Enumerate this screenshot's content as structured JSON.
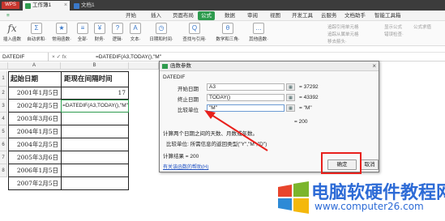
{
  "titlebar": {
    "app": "WPS",
    "tabs": [
      {
        "label": "工作簿1",
        "color": "#2e9b4e"
      },
      {
        "label": "文档1",
        "color": "#3a78c8"
      }
    ]
  },
  "menu": [
    "开始",
    "插入",
    "页面布局",
    "公式",
    "数据",
    "审阅",
    "视图",
    "开发工具",
    "云服务",
    "文档助手",
    "智能工具箱"
  ],
  "menu_active": "公式",
  "ribbon": {
    "buttons": [
      {
        "label": "插入函数",
        "icon": "fx"
      },
      {
        "label": "自动求和·",
        "icon": "Σ"
      },
      {
        "label": "常用函数·",
        "icon": "★"
      },
      {
        "label": "全部·",
        "icon": "≡"
      },
      {
        "label": "财务·",
        "icon": "¥"
      },
      {
        "label": "逻辑·",
        "icon": "?"
      },
      {
        "label": "文本·",
        "icon": "A"
      },
      {
        "label": "日期和时间·",
        "icon": "◷"
      },
      {
        "label": "查找与引用·",
        "icon": "Q"
      },
      {
        "label": "数学和三角·",
        "icon": "θ"
      },
      {
        "label": "其他函数·",
        "icon": "…"
      }
    ],
    "side_labels": [
      "追踪引用单元格",
      "追踪从属单元格",
      "移去箭头·",
      "显示公式",
      "错误检查·",
      "公式求值"
    ]
  },
  "formula_bar": {
    "name_box": "DATEDIF",
    "icons": "× ✓ fx",
    "formula": "=DATEDIF(A3,TODAY(),\"M\""
  },
  "grid": {
    "columns": [
      "A",
      "B"
    ],
    "rows": [
      "1",
      "2",
      "3",
      "4",
      "5",
      "6",
      "7",
      "8"
    ],
    "header": [
      "起始日期",
      "距现在间隔时间"
    ],
    "dates": [
      "2001年1月5日",
      "2002年2月5日",
      "2003年3月6日",
      "2004年1月5日",
      "2004年2月5日",
      "2005年3月6日",
      "2006年1月5日",
      "2007年2月5日"
    ],
    "b2_value": "17",
    "b3_formula": "=DATEDIF(A3,TODAY(),\"M\""
  },
  "dialog": {
    "title": "函数参数",
    "func": "DATEDIF",
    "args": [
      {
        "label": "开始日期",
        "value": "A3",
        "result": "= 37292"
      },
      {
        "label": "终止日期",
        "value": "TODAY()",
        "result": "= 43392"
      },
      {
        "label": "比较单位",
        "value": "\"M\"",
        "result": "= \"M\""
      }
    ],
    "total": "= 200",
    "description": "计算两个日期之间的天数、月数或年数。",
    "param_help": "比较单位: 所需信息的返回类型(\"Y\",\"M\",\"D\")",
    "calc_result": "计算结果 = 200",
    "help_link": "有关该函数的帮助(H)",
    "ok": "确定",
    "cancel": "取消"
  },
  "watermark": {
    "title": "电脑软硬件教程网",
    "url": "www.computer26.com"
  },
  "colors": {
    "accent": "#2e9b4e",
    "highlight": "#e8201c",
    "link": "#2354c4",
    "watermark": "#2d6bd6"
  }
}
